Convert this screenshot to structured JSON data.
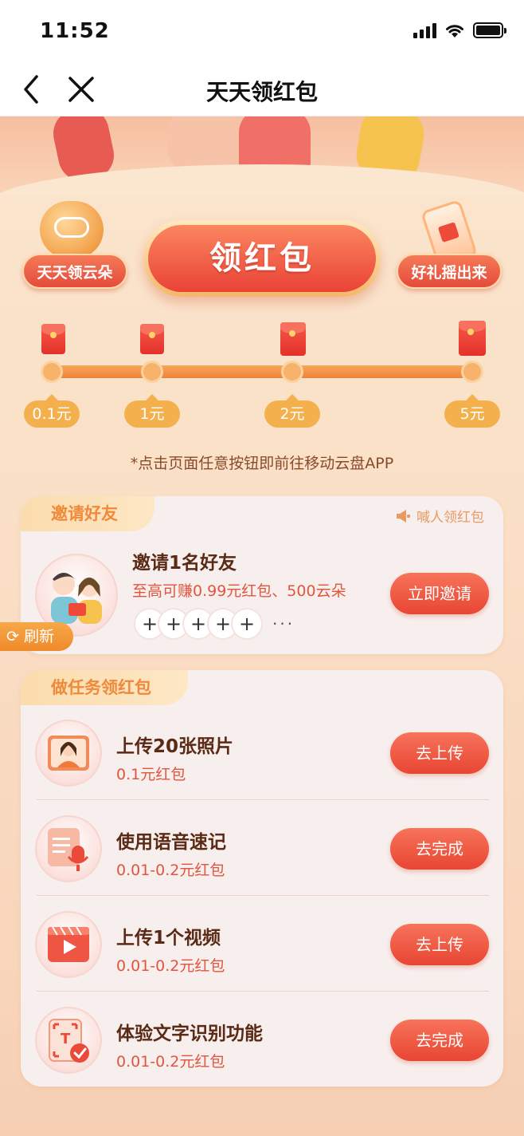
{
  "status_bar": {
    "time": "11:52"
  },
  "nav": {
    "title": "天天领红包"
  },
  "top": {
    "left_button": "天天领云朵",
    "main_button": "领红包",
    "right_button": "好礼摇出来"
  },
  "progress": {
    "levels": [
      "0.1元",
      "1元",
      "2元",
      "5元"
    ]
  },
  "hint": "*点击页面任意按钮即前往移动云盘APP",
  "invite_card": {
    "tab": "邀请好友",
    "shout": "喊人领红包",
    "title": "邀请1名好友",
    "subtitle": "至高可赚0.99元红包、500云朵",
    "button": "立即邀请",
    "plus": "+",
    "more": "···"
  },
  "refresh": "刷新",
  "task_card": {
    "tab": "做任务领红包",
    "tasks": [
      {
        "title": "上传20张照片",
        "reward": "0.1元红包",
        "button": "去上传",
        "icon": "photo-portrait-icon"
      },
      {
        "title": "使用语音速记",
        "reward": "0.01-0.2元红包",
        "button": "去完成",
        "icon": "voice-note-icon"
      },
      {
        "title": "上传1个视频",
        "reward": "0.01-0.2元红包",
        "button": "去上传",
        "icon": "video-play-icon"
      },
      {
        "title": "体验文字识别功能",
        "reward": "0.01-0.2元红包",
        "button": "去完成",
        "icon": "text-recognition-icon"
      }
    ]
  },
  "colors": {
    "accent_red": "#e84634",
    "accent_orange": "#f5b04e",
    "page_bg": "#fae1c8"
  }
}
